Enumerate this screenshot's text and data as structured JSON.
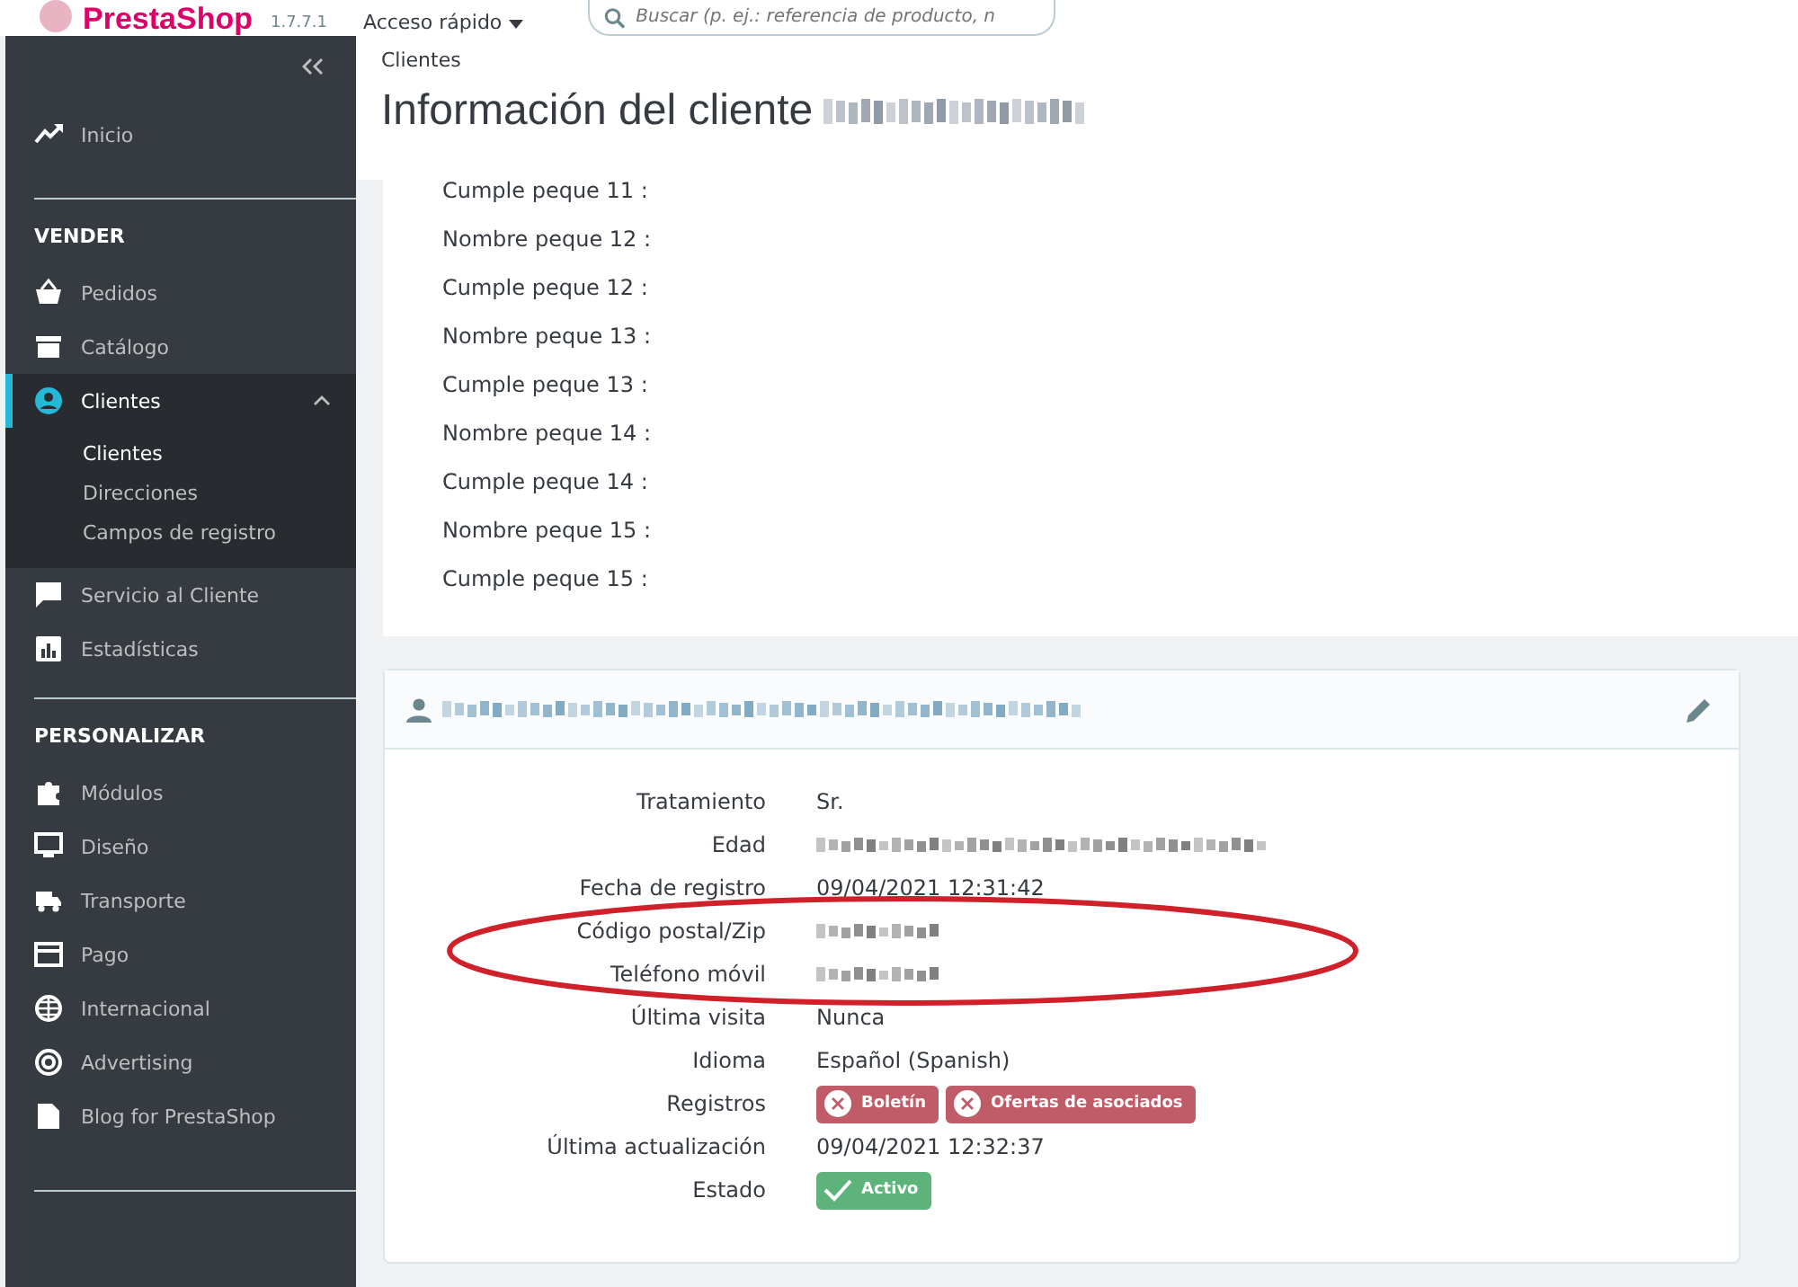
{
  "header": {
    "logo": "PrestaShop",
    "version": "1.7.7.1",
    "quick_access": "Acceso rápido",
    "search": {
      "placeholder": "Buscar (p. ej.: referencia de producto, n"
    }
  },
  "sidebar": {
    "items": [
      {
        "kind": "link",
        "label": "Inicio",
        "selected": false
      },
      {
        "kind": "section",
        "label": "VENDER"
      },
      {
        "kind": "link",
        "label": "Pedidos",
        "selected": false
      },
      {
        "kind": "link",
        "label": "Catálogo",
        "selected": false
      },
      {
        "kind": "link",
        "label": "Clientes",
        "selected": true,
        "expanded": true,
        "children": [
          {
            "label": "Clientes",
            "selected": true
          },
          {
            "label": "Direcciones",
            "selected": false
          },
          {
            "label": "Campos de registro",
            "selected": false
          }
        ]
      },
      {
        "kind": "link",
        "label": "Servicio al Cliente",
        "selected": false
      },
      {
        "kind": "link",
        "label": "Estadísticas",
        "selected": false
      },
      {
        "kind": "section",
        "label": "PERSONALIZAR"
      },
      {
        "kind": "link",
        "label": "Módulos",
        "selected": false
      },
      {
        "kind": "link",
        "label": "Diseño",
        "selected": false
      },
      {
        "kind": "link",
        "label": "Transporte",
        "selected": false
      },
      {
        "kind": "link",
        "label": "Pago",
        "selected": false
      },
      {
        "kind": "link",
        "label": "Internacional",
        "selected": false
      },
      {
        "kind": "link",
        "label": "Advertising",
        "selected": false
      },
      {
        "kind": "link",
        "label": "Blog for PrestaShop",
        "selected": false
      }
    ]
  },
  "breadcrumb": "Clientes",
  "page_title": "Información del cliente",
  "fields_card": {
    "rows": [
      "Cumple peque 11 :",
      "Nombre peque 12 :",
      "Cumple peque 12 :",
      "Nombre peque 13 :",
      "Cumple peque 13 :",
      "Nombre peque 14 :",
      "Cumple peque 14 :",
      "Nombre peque 15 :",
      "Cumple peque 15 :"
    ]
  },
  "customer_card": {
    "rows": [
      {
        "label": "Tratamiento",
        "kind": "text",
        "value": "Sr."
      },
      {
        "label": "Edad",
        "kind": "redacted"
      },
      {
        "label": "Fecha de registro",
        "kind": "text",
        "value": "09/04/2021 12:31:42"
      },
      {
        "label": "Código postal/Zip",
        "kind": "redacted"
      },
      {
        "label": "Teléfono móvil",
        "kind": "redacted"
      },
      {
        "label": "Última visita",
        "kind": "text",
        "value": "Nunca"
      },
      {
        "label": "Idioma",
        "kind": "text",
        "value": "Español (Spanish)"
      },
      {
        "label": "Registros",
        "kind": "badges",
        "badges": [
          {
            "label": "Boletín",
            "checked": false
          },
          {
            "label": "Ofertas de asociados",
            "checked": false
          }
        ]
      },
      {
        "label": "Última actualización",
        "kind": "text",
        "value": "09/04/2021 12:32:37"
      },
      {
        "label": "Estado",
        "kind": "badges",
        "badges": [
          {
            "label": "Activo",
            "checked": true
          }
        ]
      }
    ]
  },
  "highlight": {
    "kind": "ellipse"
  }
}
